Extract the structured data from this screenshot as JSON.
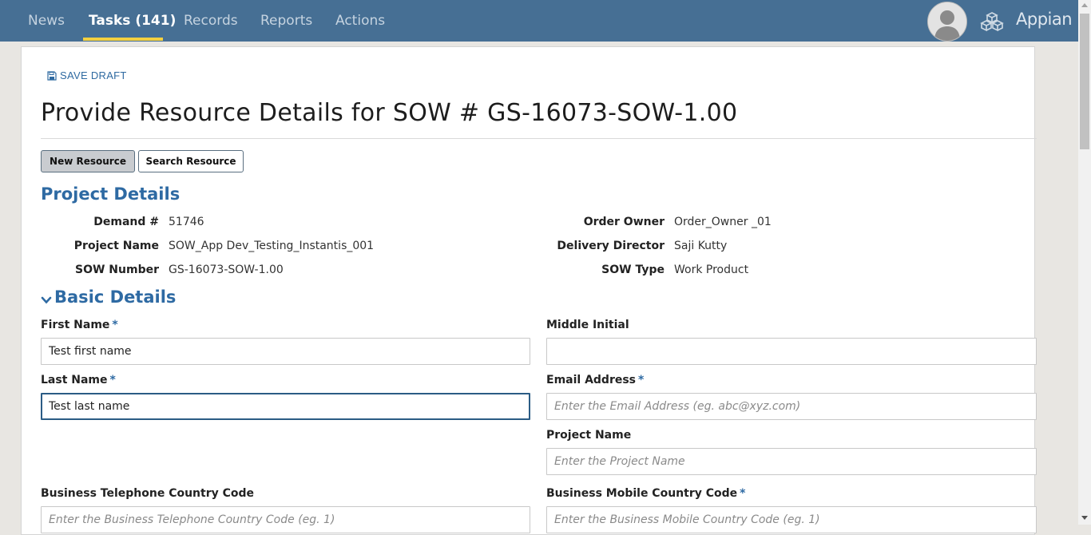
{
  "nav": {
    "items": [
      {
        "label": "News"
      },
      {
        "label": "Tasks (141)"
      },
      {
        "label": "Records"
      },
      {
        "label": "Reports"
      },
      {
        "label": "Actions"
      }
    ],
    "active_index": 1,
    "brand": "Appian",
    "icons": [
      "user-avatar",
      "apps-icon"
    ]
  },
  "toolbar": {
    "save_draft_label": "SAVE DRAFT",
    "save_icon": "floppy-disk-icon"
  },
  "page": {
    "title": "Provide Resource Details for SOW # GS-16073-SOW-1.00"
  },
  "buttons": {
    "new_resource": "New Resource",
    "search_resource": "Search Resource"
  },
  "project_details": {
    "title": "Project Details",
    "left": [
      {
        "label": "Demand #",
        "value": "51746"
      },
      {
        "label": "Project Name",
        "value": "SOW_App Dev_Testing_Instantis_001"
      },
      {
        "label": "SOW Number",
        "value": "GS-16073-SOW-1.00"
      }
    ],
    "right": [
      {
        "label": "Order Owner",
        "value": "Order_Owner _01"
      },
      {
        "label": "Delivery Director",
        "value": "Saji Kutty"
      },
      {
        "label": "SOW Type",
        "value": "Work Product"
      }
    ]
  },
  "basic_details": {
    "title": "Basic Details",
    "first_name": {
      "label": "First Name",
      "required_marker": "*",
      "value": "Test first name",
      "placeholder": ""
    },
    "middle_initial": {
      "label": "Middle Initial",
      "value": "",
      "placeholder": ""
    },
    "last_name": {
      "label": "Last Name",
      "required_marker": "*",
      "value": "Test last name",
      "placeholder": ""
    },
    "email": {
      "label": "Email Address",
      "required_marker": "*",
      "value": "",
      "placeholder": "Enter the Email Address (eg. abc@xyz.com)"
    },
    "project_name": {
      "label": "Project Name",
      "value": "",
      "placeholder": "Enter the Project Name"
    },
    "biz_tel_cc": {
      "label": "Business Telephone Country Code",
      "value": "",
      "placeholder": "Enter the Business Telephone Country Code (eg. 1)"
    },
    "biz_mob_cc": {
      "label": "Business Mobile Country Code",
      "required_marker": "*",
      "value": "",
      "placeholder": "Enter the Business Mobile Country Code (eg. 1)"
    }
  },
  "colors": {
    "nav_bg": "#466f94",
    "accent": "#2e6aa3",
    "active_underline": "#f4d03f"
  }
}
